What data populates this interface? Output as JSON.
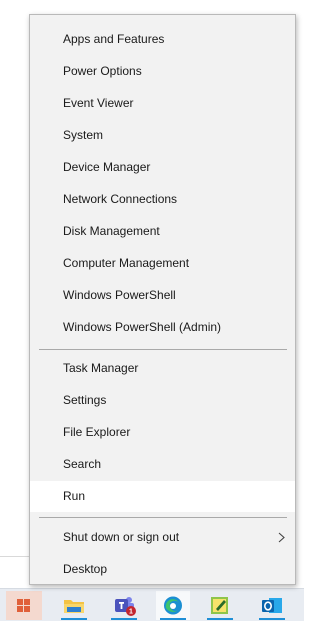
{
  "menu": {
    "group1": [
      {
        "label": "Apps and Features"
      },
      {
        "label": "Power Options"
      },
      {
        "label": "Event Viewer"
      },
      {
        "label": "System"
      },
      {
        "label": "Device Manager"
      },
      {
        "label": "Network Connections"
      },
      {
        "label": "Disk Management"
      },
      {
        "label": "Computer Management"
      },
      {
        "label": "Windows PowerShell"
      },
      {
        "label": "Windows PowerShell (Admin)"
      }
    ],
    "group2": [
      {
        "label": "Task Manager"
      },
      {
        "label": "Settings"
      },
      {
        "label": "File Explorer"
      },
      {
        "label": "Search"
      },
      {
        "label": "Run",
        "highlighted": true
      }
    ],
    "group3": [
      {
        "label": "Shut down or sign out",
        "submenu": true
      },
      {
        "label": "Desktop"
      }
    ]
  },
  "taskbar": {
    "items": [
      {
        "icon": "windows-start-icon"
      },
      {
        "icon": "file-explorer-icon"
      },
      {
        "icon": "teams-icon",
        "badge": "1"
      },
      {
        "icon": "edge-icon",
        "active": true
      },
      {
        "icon": "sticky-notes-icon"
      },
      {
        "icon": "outlook-icon"
      }
    ]
  },
  "colors": {
    "menu_bg": "#f2f2f2",
    "highlight_bg": "#ffffff",
    "taskbar_bg": "#e8ecf2",
    "accent": "#1f8fd6",
    "badge": "#c4262e"
  }
}
